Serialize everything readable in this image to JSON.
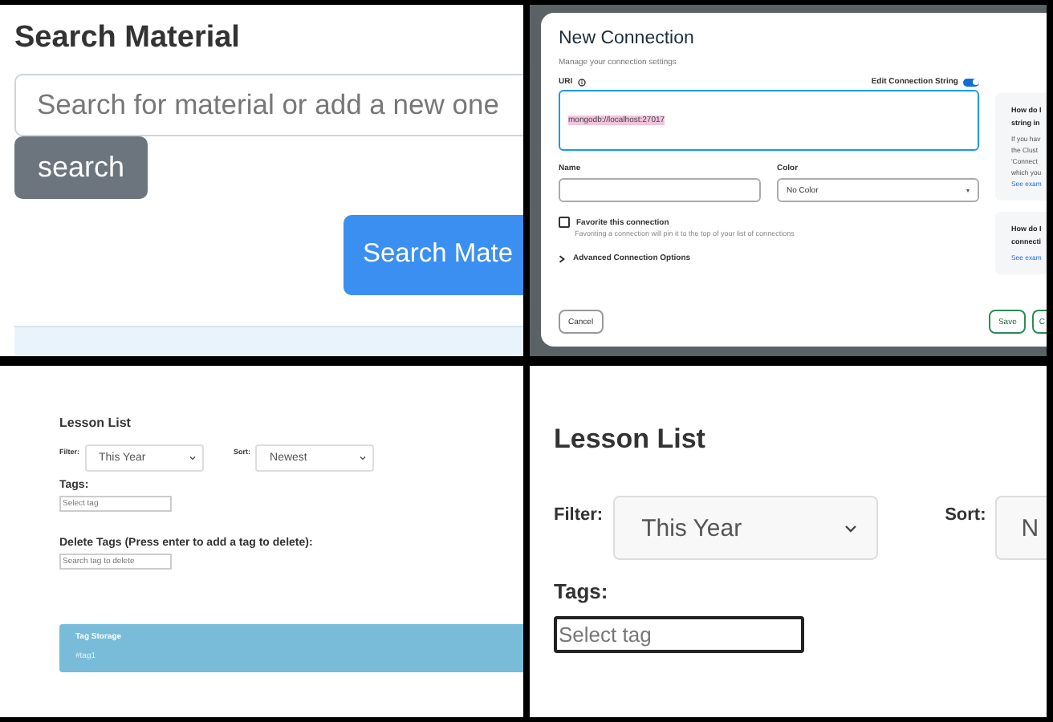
{
  "search_material": {
    "title": "Search Material",
    "search_field": {
      "placeholder": "Search for material or add a new one"
    },
    "search_button": "search",
    "submit_button": "Search Mate"
  },
  "new_connection": {
    "title": "New Connection",
    "subtitle": "Manage your connection settings",
    "uri_label": "URI",
    "edit_toggle": {
      "label": "Edit Connection String",
      "on": true
    },
    "uri_value": "mongodb://localhost:27017",
    "name_label": "Name",
    "color_label": "Color",
    "color_value": "No Color",
    "favorite": {
      "label": "Favorite this connection",
      "checked": false,
      "hint": "Favoriting a connection will pin it to the top of your list of connections"
    },
    "advanced": {
      "label": "Advanced Connection Options",
      "expanded": false
    },
    "help_cards": [
      {
        "lines": [
          "How do I",
          "string in"
        ],
        "body": [
          "If you hav",
          "the Clust",
          "'Connect",
          "which you"
        ],
        "link": "See exam"
      },
      {
        "lines": [
          "How do I",
          "connecti"
        ],
        "link": "See exam"
      }
    ],
    "cancel_button": "Cancel",
    "save_button": "Save",
    "connect_button": "C"
  },
  "lesson_list_small": {
    "title": "Lesson List",
    "filter_label": "Filter:",
    "filter_value": "This Year",
    "sort_label": "Sort:",
    "sort_value": "Newest",
    "tags_label": "Tags:",
    "tags_field": {
      "placeholder": "Select tag"
    },
    "delete_label": "Delete Tags (Press enter to add a tag to delete):",
    "delete_field": {
      "placeholder": "Search tag to delete"
    },
    "storage_title": "Tag Storage",
    "storage_tags": [
      "#tag1"
    ]
  },
  "lesson_list_large": {
    "title": "Lesson List",
    "filter_label": "Filter:",
    "filter_value": "This Year",
    "sort_label": "Sort:",
    "sort_value": "N",
    "tags_label": "Tags:",
    "tags_field": {
      "placeholder": "Select tag"
    }
  }
}
